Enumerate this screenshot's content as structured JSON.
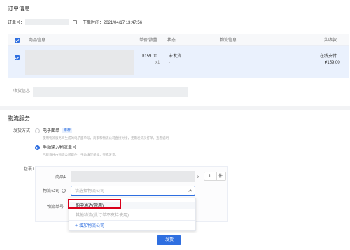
{
  "order": {
    "section_title": "订单信息",
    "order_no_label": "订单号：",
    "order_time": "下单时间：2021/04/17 13:47:56",
    "columns": [
      "商品信息",
      "单价/数量",
      "状态",
      "物流信息",
      "实收款"
    ],
    "row": {
      "price": "¥159.00",
      "qty": "x1",
      "status": "未发货",
      "status_sub": "-",
      "pay_status": "在线支付",
      "received": "¥159.00"
    },
    "receiver_label": "收货信息"
  },
  "logistics": {
    "section_title": "物流服务",
    "method_label": "发货方式",
    "option_electronic": "电子面单",
    "recommend_badge": "推荐",
    "option_electronic_desc": "使用物流服务商生成的电子面单号，商家和物流公司直接对接，无需发货员打单。查看说明",
    "option_manual": "手动输入物流单号",
    "option_manual_desc": "已联系并由物流公司取件，手动填写单号，完成发货。",
    "package_label": "包裹1",
    "product_label": "商品1",
    "multiply": "x",
    "qty_value": "1",
    "qty_unit": "件",
    "company_label": "物流公司",
    "company_placeholder": "请选择物流公司",
    "tracking_label": "物流单号",
    "dropdown": {
      "options": [
        "韵中通达(常用)",
        "其他物流(此订单不支持使用)"
      ],
      "add_label": "增加物流公司"
    },
    "submit_label": "发货"
  },
  "colors": {
    "accent": "#2f6fe0",
    "highlight": "#d9001b"
  }
}
